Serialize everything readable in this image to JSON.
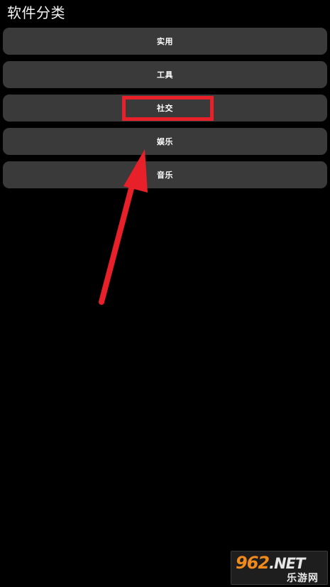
{
  "header": {
    "title": "软件分类"
  },
  "categories": [
    {
      "label": "实用"
    },
    {
      "label": "工具"
    },
    {
      "label": "社交"
    },
    {
      "label": "娱乐"
    },
    {
      "label": "音乐"
    }
  ],
  "annotation": {
    "highlighted_item": "社交",
    "color": "#e8202a"
  },
  "watermark": {
    "digits": "962",
    "suffix": ".NET",
    "subtitle": "乐游网"
  },
  "colors": {
    "background": "#000000",
    "item_background": "#3a3a3a",
    "text": "#ffffff",
    "annotation_red": "#e8202a",
    "watermark_orange": "#f08a1c"
  }
}
